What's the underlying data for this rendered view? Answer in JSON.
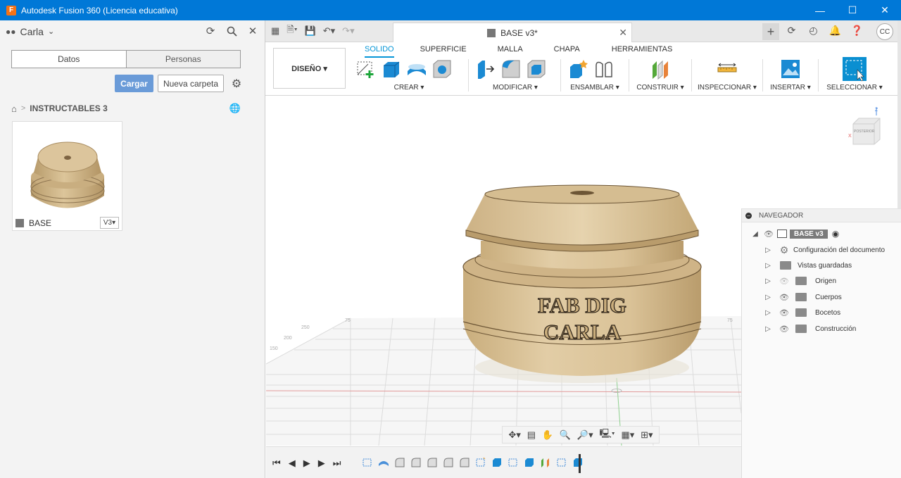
{
  "window": {
    "title": "Autodesk Fusion 360 (Licencia educativa)",
    "app_icon_letter": "F",
    "minimize": "—",
    "maximize": "☐",
    "close": "✕"
  },
  "data_panel": {
    "user": "Carla",
    "tabs": [
      "Datos",
      "Personas"
    ],
    "upload_label": "Cargar",
    "new_folder_label": "Nueva carpeta",
    "breadcrumb_folder": "INSTRUCTABLES 3",
    "items": [
      {
        "name": "BASE",
        "version": "V3▾"
      }
    ]
  },
  "app_bar": {
    "doc_tab_title": "BASE v3*",
    "user_initials": "CC"
  },
  "ribbon": {
    "workspace": "DISEÑO ▾",
    "tabs": [
      "SOLIDO",
      "SUPERFICIE",
      "MALLA",
      "CHAPA",
      "HERRAMIENTAS"
    ],
    "active_tab": "SOLIDO",
    "groups": [
      "CREAR ▾",
      "MODIFICAR ▾",
      "ENSAMBLAR ▾",
      "CONSTRUIR ▾",
      "INSPECCIONAR ▾",
      "INSERTAR ▾",
      "SELECCIONAR ▾"
    ]
  },
  "viewport": {
    "model_text_line1": "FAB DIG",
    "model_text_line2": "CARLA",
    "viewcube_face": "POSTERIOR",
    "grid_labels": [
      "250",
      "200",
      "150",
      "75",
      "75"
    ]
  },
  "navigator": {
    "title": "NAVEGADOR",
    "root": "BASE v3",
    "nodes": [
      "Configuración del documento",
      "Vistas guardadas",
      "Origen",
      "Cuerpos",
      "Bocetos",
      "Construcción"
    ]
  },
  "colors": {
    "titlebar": "#0078d7",
    "accent": "#0696d7",
    "model": "#d8bf92",
    "upload_button": "#6a9bd8"
  }
}
